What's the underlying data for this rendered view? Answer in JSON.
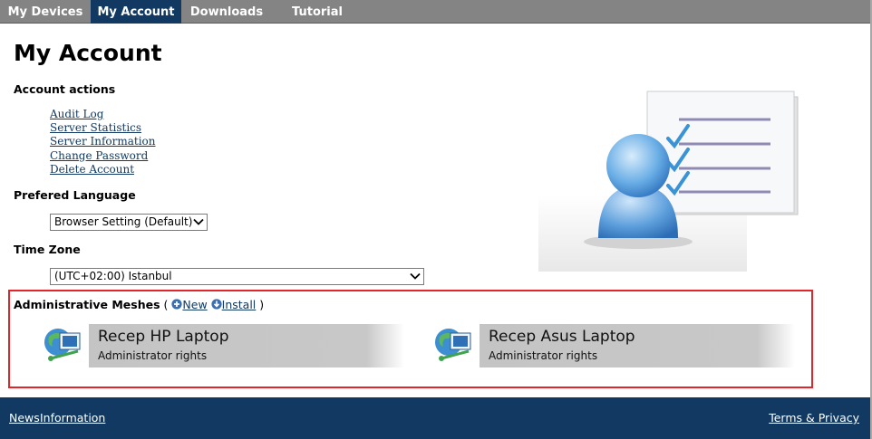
{
  "tabs": [
    {
      "label": "My Devices"
    },
    {
      "label": "My Account",
      "active": true
    },
    {
      "label": "Downloads"
    },
    {
      "label": "Tutorial"
    }
  ],
  "page": {
    "title": "My Account"
  },
  "account_actions": {
    "heading": "Account actions",
    "links": [
      "Audit Log",
      "Server Statistics",
      "Server Information",
      "Change Password",
      "Delete Account"
    ]
  },
  "language": {
    "heading": "Prefered Language",
    "selected": "Browser Setting (Default)"
  },
  "timezone": {
    "heading": "Time Zone",
    "selected": "(UTC+02:00) Istanbul"
  },
  "meshes": {
    "heading": "Administrative Meshes",
    "open_paren": "(",
    "new_label": "New",
    "install_label": "Install",
    "close_paren": ")",
    "items": [
      {
        "name": "Recep HP Laptop",
        "rights": "Administrator rights"
      },
      {
        "name": "Recep Asus Laptop",
        "rights": "Administrator rights"
      }
    ]
  },
  "footer": {
    "news": "News",
    "information": "Information",
    "terms": "Terms & Privacy"
  },
  "colors": {
    "accent": "#113962",
    "tabbar": "#848484",
    "highlight_border": "#e0262b"
  }
}
